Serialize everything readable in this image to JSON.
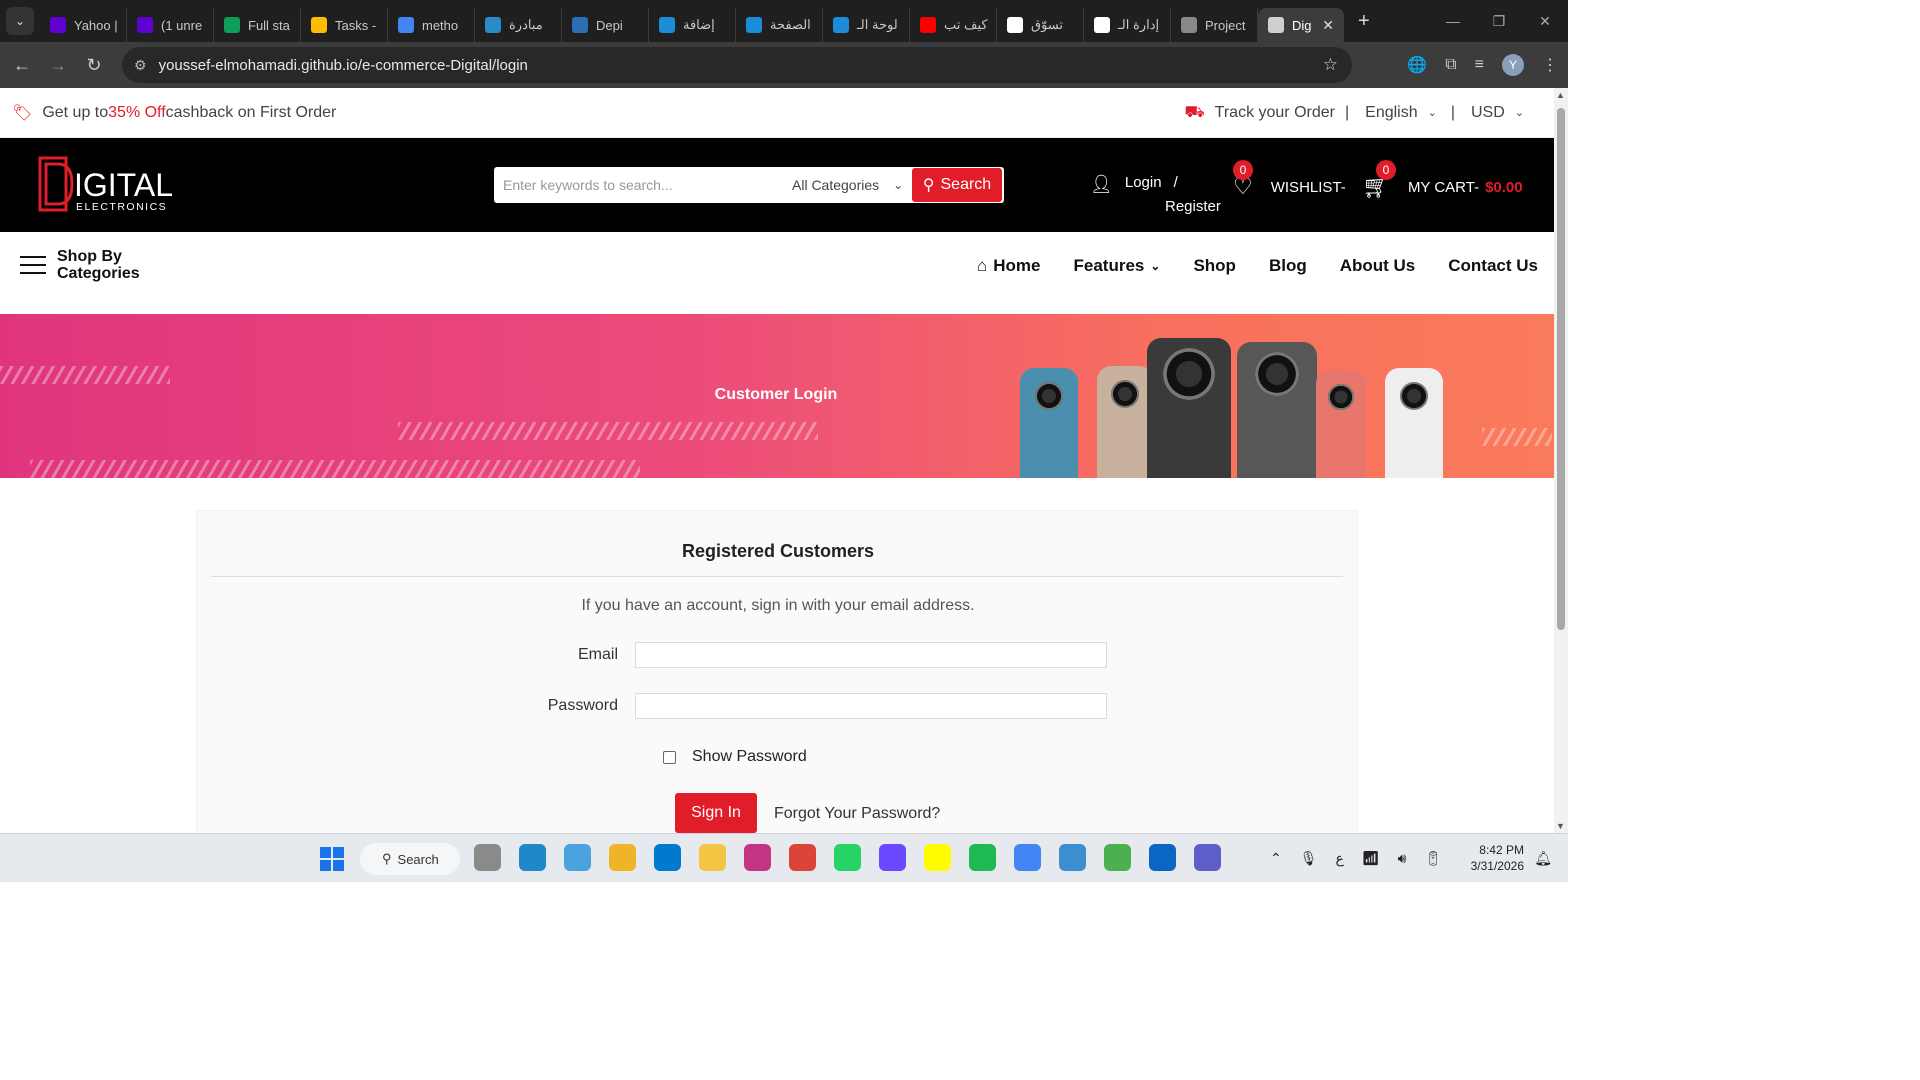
{
  "browser": {
    "tabs": [
      {
        "label": "Yahoo |",
        "color": "#6001d2"
      },
      {
        "label": "(1 unre",
        "color": "#6001d2"
      },
      {
        "label": "Full sta",
        "color": "#0f9d58"
      },
      {
        "label": "Tasks -",
        "color": "#fbbc04"
      },
      {
        "label": "metho",
        "color": "#4285f4"
      },
      {
        "label": "مبادرة",
        "color": "#2a8bc9"
      },
      {
        "label": "Depi",
        "color": "#2a6fb5"
      },
      {
        "label": "إضافة",
        "color": "#1a8cd8"
      },
      {
        "label": "الصفحة",
        "color": "#1a8cd8"
      },
      {
        "label": "لوحة الـ",
        "color": "#1a8cd8"
      },
      {
        "label": "كيف تب",
        "color": "#ff0000"
      },
      {
        "label": "تسوّق",
        "color": "#ffffff"
      },
      {
        "label": "إدارة الـ",
        "color": "#ffffff"
      },
      {
        "label": "Project",
        "color": "#888888"
      },
      {
        "label": "Dig",
        "color": "#cfcfcf"
      }
    ],
    "url": "youssef-elmohamadi.github.io/e-commerce-Digital/login",
    "profile_initial": "Y"
  },
  "promo": {
    "prefix": "Get up to ",
    "highlight": "35% Off",
    "suffix": " cashback on First Order",
    "track": "Track your Order",
    "divider": "|",
    "language": "English",
    "currency": "USD"
  },
  "header": {
    "logo_main": "IGITAL",
    "logo_sub": "ELECTRONICS",
    "search_placeholder": "Enter keywords to search...",
    "category": "All Categories",
    "search_button": "Search",
    "login": "Login",
    "slash": "/",
    "register": "Register",
    "wishlist_count": "0",
    "wishlist": "WISHLIST-",
    "cart_count": "0",
    "cart": "MY CART-",
    "cart_total": "$0.00"
  },
  "nav": {
    "shop_by": "Shop By Categories",
    "items": [
      "Home",
      "Features",
      "Shop",
      "Blog",
      "About Us",
      "Contact Us"
    ]
  },
  "banner": {
    "title": "Customer Login",
    "accent": "#e0357d"
  },
  "login": {
    "heading": "Registered Customers",
    "intro": "If you have an account, sign in with your email address.",
    "email_label": "Email",
    "email_value": "",
    "password_label": "Password",
    "password_value": "",
    "show_password": "Show Password",
    "sign_in": "Sign In",
    "forgot": "Forgot Your Password?"
  },
  "taskbar": {
    "search": "Search",
    "time": "8:42 PM",
    "date": "3/31/2026"
  }
}
